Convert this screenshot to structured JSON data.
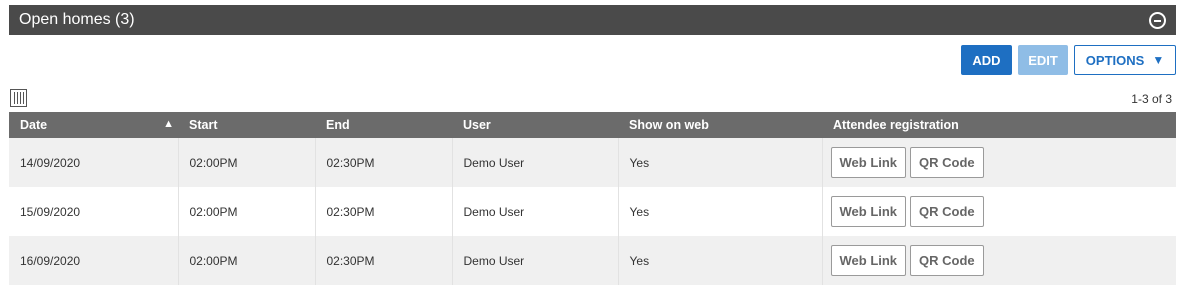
{
  "panel": {
    "title": "Open homes (3)"
  },
  "toolbar": {
    "add_label": "ADD",
    "edit_label": "EDIT",
    "options_label": "OPTIONS"
  },
  "pager": {
    "text": "1-3 of 3"
  },
  "table": {
    "headers": [
      "Date",
      "Start",
      "End",
      "User",
      "Show on web",
      "Attendee registration"
    ],
    "sort": {
      "column": "Date",
      "direction": "ascending"
    },
    "rows": [
      {
        "date": "14/09/2020",
        "start": "02:00PM",
        "end": "02:30PM",
        "user": "Demo User",
        "show_on_web": "Yes",
        "web_link": "Web Link",
        "qr_code": "QR Code"
      },
      {
        "date": "15/09/2020",
        "start": "02:00PM",
        "end": "02:30PM",
        "user": "Demo User",
        "show_on_web": "Yes",
        "web_link": "Web Link",
        "qr_code": "QR Code"
      },
      {
        "date": "16/09/2020",
        "start": "02:00PM",
        "end": "02:30PM",
        "user": "Demo User",
        "show_on_web": "Yes",
        "web_link": "Web Link",
        "qr_code": "QR Code"
      }
    ]
  },
  "icons": {
    "collapse": "minus-circle-icon",
    "columns": "columns-icon",
    "sort": "sort-ascending-icon",
    "dropdown": "triangle-down-icon"
  },
  "colors": {
    "header_bg": "#4a4a4a",
    "table_header_bg": "#6b6b6b",
    "primary": "#1e6fc2",
    "primary_disabled": "#8fbde6"
  }
}
